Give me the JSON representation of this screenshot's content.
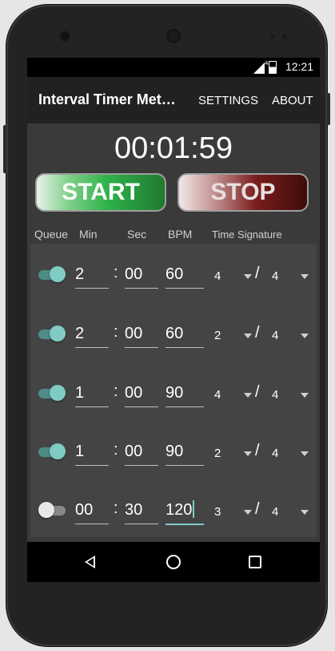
{
  "status_bar": {
    "time": "12:21",
    "network": "4G"
  },
  "action_bar": {
    "title": "Interval Timer Met…",
    "menu": {
      "settings": "SETTINGS",
      "about": "ABOUT"
    }
  },
  "timer": {
    "display": "00:01:59"
  },
  "controls": {
    "start": "START",
    "stop": "STOP"
  },
  "columns": {
    "queue": "Queue",
    "min": "Min",
    "sec": "Sec",
    "bpm": "BPM",
    "time_signature": "Time Signature"
  },
  "rows": [
    {
      "enabled": true,
      "min": "2",
      "sec": "00",
      "bpm": "60",
      "beats": "4",
      "note": "4"
    },
    {
      "enabled": true,
      "min": "2",
      "sec": "00",
      "bpm": "60",
      "beats": "2",
      "note": "4"
    },
    {
      "enabled": true,
      "min": "1",
      "sec": "00",
      "bpm": "90",
      "beats": "4",
      "note": "4"
    },
    {
      "enabled": true,
      "min": "1",
      "sec": "00",
      "bpm": "90",
      "beats": "2",
      "note": "4"
    },
    {
      "enabled": false,
      "min": "00",
      "sec": "30",
      "bpm": "120",
      "beats": "3",
      "note": "4"
    }
  ],
  "separators": {
    "colon": ":",
    "slash": "/"
  },
  "colors": {
    "accent": "#80cbc4",
    "start_green": "#2fb24a",
    "stop_red": "#7a1d1d",
    "background": "#3a3a3a"
  }
}
